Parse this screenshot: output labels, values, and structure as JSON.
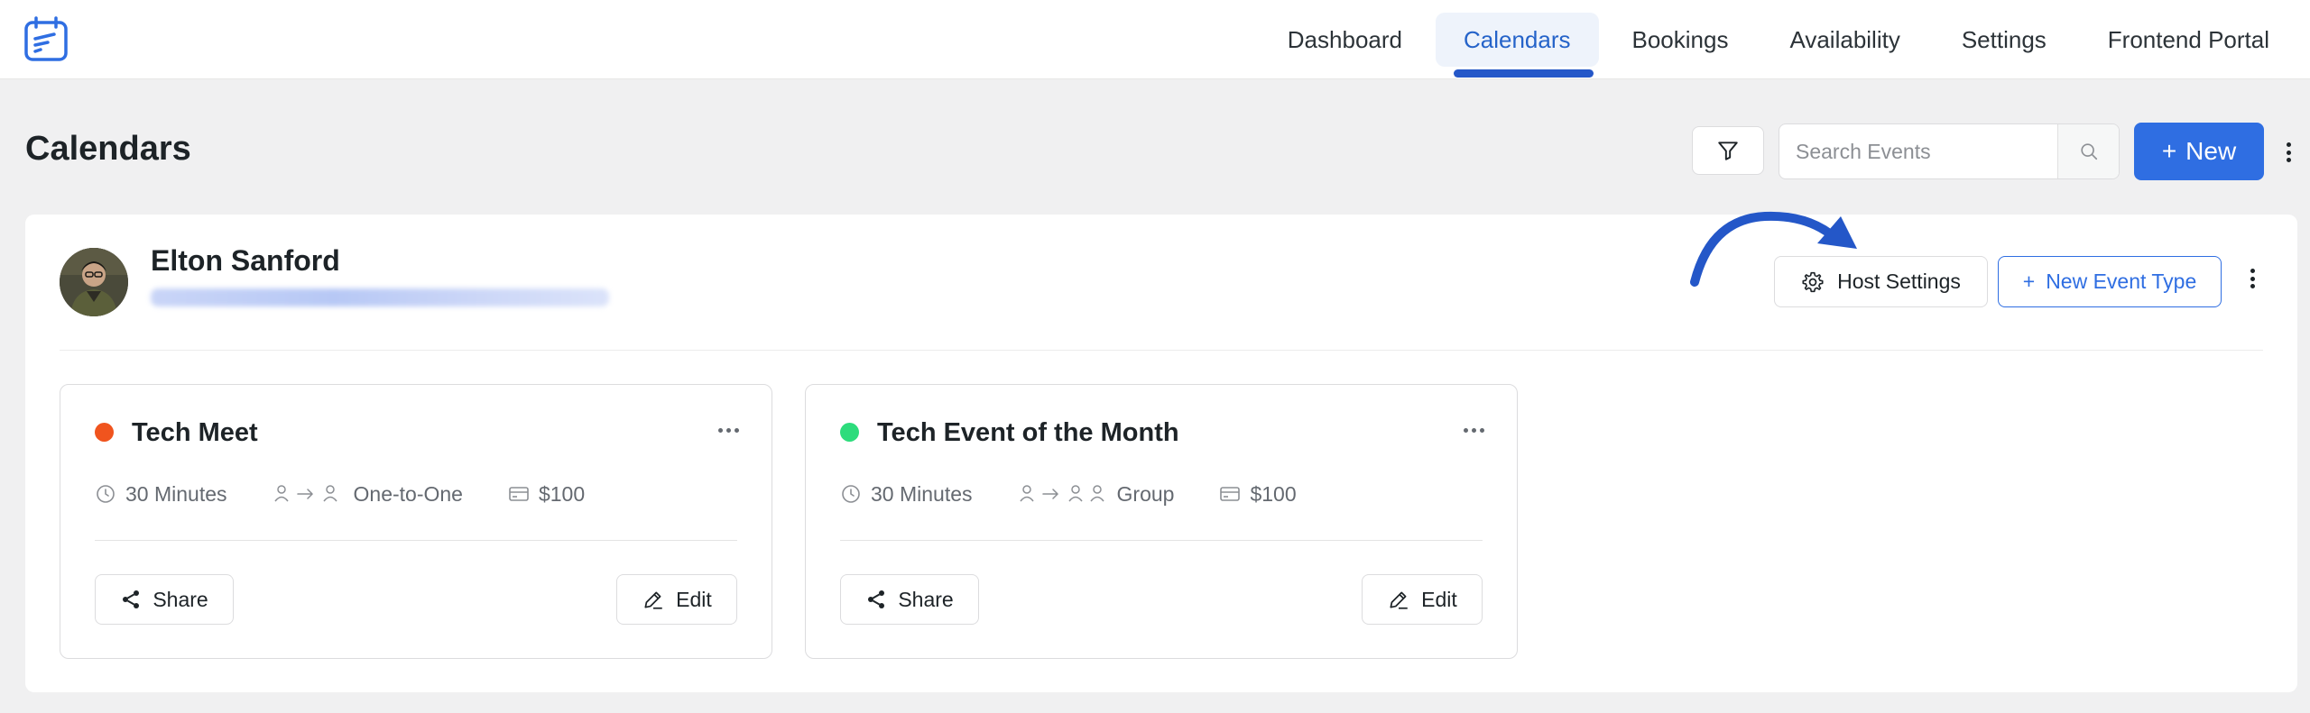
{
  "nav": {
    "items": [
      {
        "label": "Dashboard",
        "active": false
      },
      {
        "label": "Calendars",
        "active": true
      },
      {
        "label": "Bookings",
        "active": false
      },
      {
        "label": "Availability",
        "active": false
      },
      {
        "label": "Settings",
        "active": false
      },
      {
        "label": "Frontend Portal",
        "active": false
      }
    ]
  },
  "header": {
    "title": "Calendars",
    "search_placeholder": "Search Events",
    "new_button_label": "New",
    "new_button_icon": "+"
  },
  "host": {
    "name": "Elton Sanford",
    "settings_button_label": "Host Settings",
    "new_event_type_label": "New Event Type",
    "new_event_type_icon": "+"
  },
  "events": [
    {
      "title": "Tech Meet",
      "dot_color": "#f0541e",
      "duration": "30 Minutes",
      "type": "One-to-One",
      "price": "$100",
      "share_label": "Share",
      "edit_label": "Edit"
    },
    {
      "title": "Tech Event of the Month",
      "dot_color": "#2ddc7c",
      "duration": "30 Minutes",
      "type": "Group",
      "price": "$100",
      "share_label": "Share",
      "edit_label": "Edit"
    }
  ],
  "colors": {
    "accent": "#2f6ee2",
    "nav_active_text": "#2563c9",
    "arrow": "#2457c8"
  }
}
